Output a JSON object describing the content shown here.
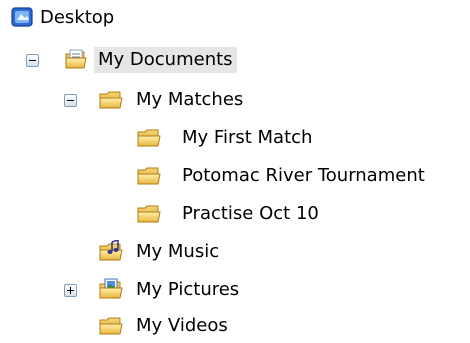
{
  "tree": {
    "desktop": {
      "label": "Desktop",
      "icon": "desktop-icon"
    },
    "my_documents": {
      "label": "My Documents",
      "icon": "documents-folder-icon",
      "expanded": true,
      "selected": true
    },
    "my_matches": {
      "label": "My Matches",
      "icon": "open-folder-icon",
      "expanded": true
    },
    "my_first_match": {
      "label": "My First Match",
      "icon": "folder-icon"
    },
    "potomac_river_tournament": {
      "label": "Potomac River Tournament",
      "icon": "folder-icon"
    },
    "practise_oct_10": {
      "label": "Practise Oct 10",
      "icon": "folder-icon"
    },
    "my_music": {
      "label": "My Music",
      "icon": "music-folder-icon"
    },
    "my_pictures": {
      "label": "My Pictures",
      "icon": "pictures-folder-icon",
      "expanded": false
    },
    "my_videos": {
      "label": "My Videos",
      "icon": "folder-icon"
    }
  },
  "colors": {
    "folder": "#f2cc5c",
    "folder_dark": "#c9951a",
    "selection": "#e6e6e6",
    "expander_border": "#7f9db9"
  }
}
